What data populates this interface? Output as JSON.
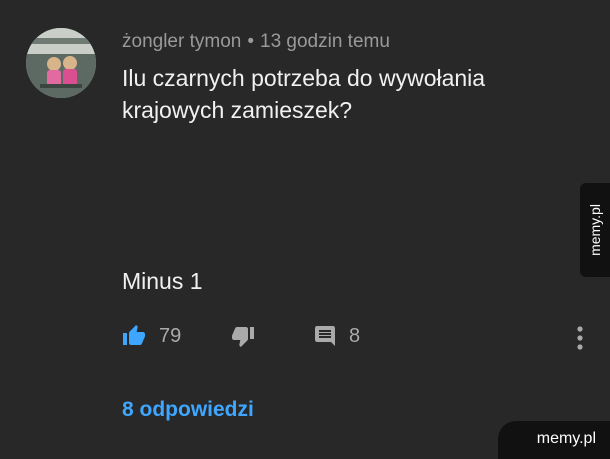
{
  "comment": {
    "author": "żongler tymon",
    "separator": "•",
    "time": "13 godzin temu",
    "text_line1": "Ilu czarnych potrzeba do wywołania",
    "text_line2": "krajowych zamieszek?"
  },
  "overlay_text": "Minus 1",
  "actions": {
    "like_count": "79",
    "reply_count": "8",
    "like_icon": "thumbs-up-icon",
    "dislike_icon": "thumbs-down-icon",
    "reply_icon": "comment-icon",
    "more_icon": "more-vert-icon"
  },
  "replies_link": "8 odpowiedzi",
  "watermark": {
    "side": "memy.pl",
    "corner": "memy.pl"
  },
  "colors": {
    "background": "#282828",
    "link": "#3ea6ff",
    "like_active": "#3ea6ff",
    "muted": "#aaaaaa"
  }
}
